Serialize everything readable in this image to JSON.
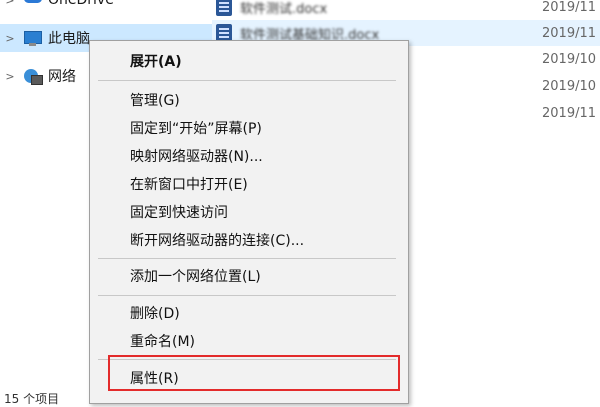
{
  "nav": {
    "onedrive": "OneDrive",
    "this_pc": "此电脑",
    "network": "网络"
  },
  "files": [
    {
      "name": "软件测试.docx",
      "date": "2019/11"
    },
    {
      "name": "软件测试基础知识.docx",
      "date": "2019/11"
    }
  ],
  "dates_only": [
    "2019/10",
    "2019/10",
    "2019/11"
  ],
  "status_text": "15 个项目",
  "context_menu": {
    "items": [
      {
        "label": "展开(A)",
        "bold": true
      },
      {
        "label": "管理(G)"
      },
      {
        "label": "固定到“开始”屏幕(P)"
      },
      {
        "label": "映射网络驱动器(N)..."
      },
      {
        "label": "在新窗口中打开(E)"
      },
      {
        "label": "固定到快速访问"
      },
      {
        "label": "断开网络驱动器的连接(C)..."
      },
      {
        "label": "添加一个网络位置(L)"
      },
      {
        "label": "删除(D)"
      },
      {
        "label": "重命名(M)"
      },
      {
        "label": "属性(R)"
      }
    ]
  },
  "colors": {
    "selection": "#cce8ff",
    "menu_bg": "#f2f2f2",
    "highlight": "#e32b2b"
  },
  "icons": {
    "onedrive": "cloud-icon",
    "this_pc": "computer-icon",
    "network": "network-icon",
    "file": "word-document-icon"
  }
}
